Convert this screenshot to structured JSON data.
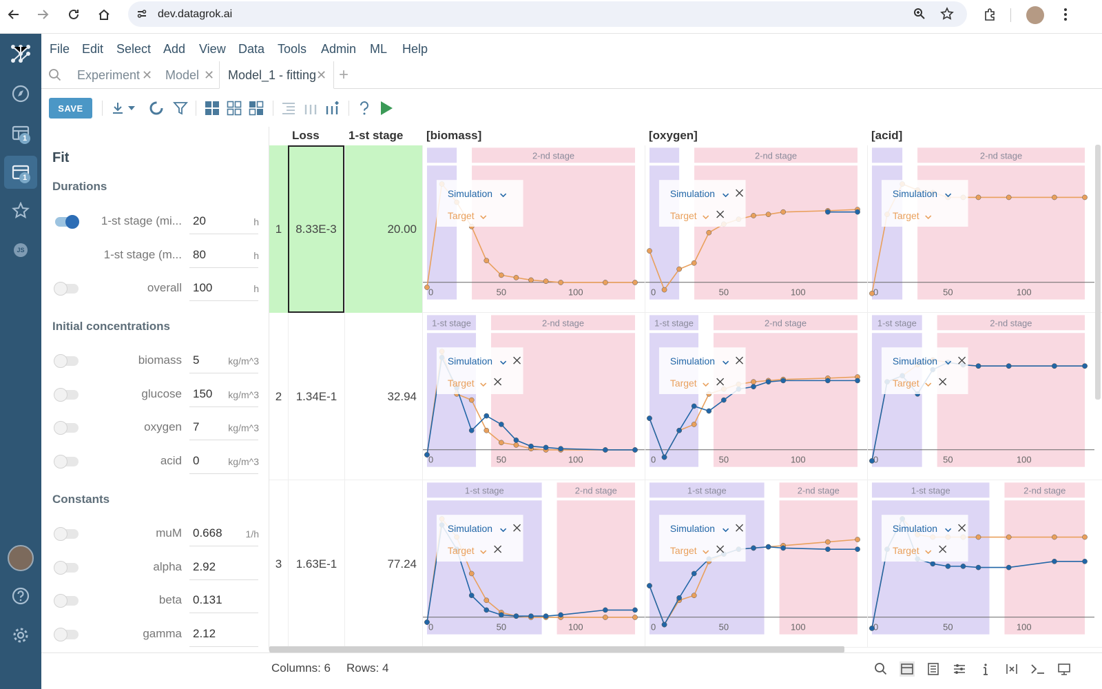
{
  "browser": {
    "url": "dev.datagrok.ai"
  },
  "menu": [
    "File",
    "Edit",
    "Select",
    "Add",
    "View",
    "Data",
    "Tools",
    "Admin",
    "ML",
    "Help"
  ],
  "tabs": [
    {
      "label": "Experiment",
      "active": false
    },
    {
      "label": "Model",
      "active": false
    },
    {
      "label": "Model_1 - fitting",
      "active": true
    }
  ],
  "sidebar": {
    "badge_tables": "1",
    "badge_projects": "1",
    "js_label": "JS"
  },
  "toolbar": {
    "save_label": "SAVE"
  },
  "fit": {
    "title": "Fit",
    "durations_title": "Durations",
    "durations": [
      {
        "label": "1-st stage (mi...",
        "value": "20",
        "unit": "h",
        "toggle": true,
        "show_toggle": true
      },
      {
        "label": "1-st stage (m...",
        "value": "80",
        "unit": "h",
        "toggle": false,
        "show_toggle": false
      },
      {
        "label": "overall",
        "value": "100",
        "unit": "h",
        "toggle": false,
        "show_toggle": true
      }
    ],
    "initial_title": "Initial concentrations",
    "initial": [
      {
        "label": "biomass",
        "value": "5",
        "unit": "kg/m^3"
      },
      {
        "label": "glucose",
        "value": "150",
        "unit": "kg/m^3"
      },
      {
        "label": "oxygen",
        "value": "7",
        "unit": "kg/m^3"
      },
      {
        "label": "acid",
        "value": "0",
        "unit": "kg/m^3"
      }
    ],
    "constants_title": "Constants",
    "constants": [
      {
        "label": "muM",
        "value": "0.668",
        "unit": "1/h"
      },
      {
        "label": "alpha",
        "value": "2.92",
        "unit": ""
      },
      {
        "label": "beta",
        "value": "0.131",
        "unit": ""
      },
      {
        "label": "gamma",
        "value": "2.12",
        "unit": ""
      }
    ]
  },
  "grid": {
    "headers": {
      "loss": "Loss",
      "stage": "1-st stage",
      "biomass": "[biomass]",
      "oxygen": "[oxygen]",
      "acid": "[acid]"
    },
    "rows": [
      {
        "num": "1",
        "loss": "8.33E-3",
        "stage": "20.00"
      },
      {
        "num": "2",
        "loss": "1.34E-1",
        "stage": "32.94"
      },
      {
        "num": "3",
        "loss": "1.63E-1",
        "stage": "77.24"
      }
    ],
    "stage1_label": "1-st stage",
    "stage2_label": "2-nd stage",
    "sim_label": "Simulation",
    "target_label": "Target",
    "axis_ticks": [
      "0",
      "50",
      "100"
    ]
  },
  "chart_data": {
    "type": "line",
    "xlim": [
      0,
      140
    ],
    "stage_ends": [
      20,
      32.94,
      77.24
    ],
    "rows": [
      {
        "biomass": {
          "target": [
            [
              0,
              0.1
            ],
            [
              10,
              0.95
            ],
            [
              20,
              0.8
            ],
            [
              30,
              0.6
            ],
            [
              40,
              0.32
            ],
            [
              50,
              0.2
            ],
            [
              60,
              0.18
            ],
            [
              70,
              0.16
            ],
            [
              80,
              0.15
            ],
            [
              90,
              0.14
            ],
            [
              120,
              0.14
            ],
            [
              140,
              0.14
            ]
          ],
          "simulation": []
        },
        "oxygen": {
          "target": [
            [
              0,
              0.4
            ],
            [
              10,
              0.08
            ],
            [
              20,
              0.25
            ],
            [
              30,
              0.3
            ],
            [
              40,
              0.55
            ],
            [
              50,
              0.62
            ],
            [
              60,
              0.66
            ],
            [
              70,
              0.69
            ],
            [
              80,
              0.7
            ],
            [
              90,
              0.72
            ],
            [
              120,
              0.73
            ],
            [
              140,
              0.74
            ]
          ],
          "simulation": [
            [
              120,
              0.72
            ],
            [
              140,
              0.72
            ]
          ]
        },
        "acid": {
          "target": [
            [
              0,
              0.05
            ],
            [
              10,
              0.7
            ],
            [
              20,
              0.95
            ],
            [
              30,
              0.9
            ],
            [
              40,
              0.88
            ],
            [
              50,
              0.84
            ],
            [
              60,
              0.84
            ],
            [
              70,
              0.84
            ],
            [
              90,
              0.84
            ],
            [
              120,
              0.84
            ],
            [
              140,
              0.84
            ]
          ],
          "simulation": []
        }
      },
      {
        "biomass": {
          "target": [
            [
              0,
              0.1
            ],
            [
              10,
              0.95
            ],
            [
              20,
              0.6
            ],
            [
              30,
              0.55
            ],
            [
              40,
              0.3
            ],
            [
              50,
              0.2
            ],
            [
              60,
              0.18
            ],
            [
              70,
              0.15
            ],
            [
              80,
              0.14
            ],
            [
              90,
              0.14
            ],
            [
              120,
              0.14
            ],
            [
              140,
              0.14
            ]
          ],
          "simulation": [
            [
              0,
              0.1
            ],
            [
              10,
              0.9
            ],
            [
              20,
              0.65
            ],
            [
              30,
              0.3
            ],
            [
              40,
              0.42
            ],
            [
              50,
              0.35
            ],
            [
              60,
              0.22
            ],
            [
              70,
              0.17
            ],
            [
              80,
              0.16
            ],
            [
              90,
              0.15
            ],
            [
              120,
              0.14
            ],
            [
              140,
              0.14
            ]
          ]
        },
        "oxygen": {
          "target": [
            [
              0,
              0.4
            ],
            [
              10,
              0.08
            ],
            [
              20,
              0.3
            ],
            [
              30,
              0.35
            ],
            [
              40,
              0.6
            ],
            [
              50,
              0.64
            ],
            [
              60,
              0.68
            ],
            [
              70,
              0.7
            ],
            [
              80,
              0.71
            ],
            [
              90,
              0.72
            ],
            [
              120,
              0.73
            ],
            [
              140,
              0.74
            ]
          ],
          "simulation": [
            [
              0,
              0.4
            ],
            [
              10,
              0.08
            ],
            [
              20,
              0.3
            ],
            [
              30,
              0.5
            ],
            [
              40,
              0.46
            ],
            [
              50,
              0.55
            ],
            [
              60,
              0.64
            ],
            [
              70,
              0.66
            ],
            [
              80,
              0.7
            ],
            [
              90,
              0.71
            ],
            [
              120,
              0.71
            ],
            [
              140,
              0.71
            ]
          ]
        },
        "acid": {
          "target": [
            [
              0,
              0.05
            ],
            [
              10,
              0.7
            ],
            [
              20,
              0.75
            ],
            [
              30,
              0.84
            ],
            [
              40,
              0.88
            ],
            [
              50,
              0.86
            ],
            [
              60,
              0.84
            ],
            [
              70,
              0.83
            ],
            [
              90,
              0.83
            ],
            [
              120,
              0.83
            ],
            [
              140,
              0.83
            ]
          ],
          "simulation": [
            [
              0,
              0.05
            ],
            [
              10,
              0.7
            ],
            [
              20,
              0.75
            ],
            [
              30,
              0.6
            ],
            [
              40,
              0.8
            ],
            [
              50,
              0.86
            ],
            [
              60,
              0.84
            ],
            [
              70,
              0.83
            ],
            [
              90,
              0.83
            ],
            [
              120,
              0.83
            ],
            [
              140,
              0.83
            ]
          ]
        }
      },
      {
        "biomass": {
          "target": [
            [
              0,
              0.1
            ],
            [
              10,
              0.95
            ],
            [
              20,
              0.8
            ],
            [
              30,
              0.5
            ],
            [
              40,
              0.28
            ],
            [
              50,
              0.18
            ],
            [
              60,
              0.15
            ],
            [
              70,
              0.14
            ],
            [
              80,
              0.14
            ],
            [
              90,
              0.14
            ],
            [
              120,
              0.14
            ],
            [
              140,
              0.14
            ]
          ],
          "simulation": [
            [
              0,
              0.1
            ],
            [
              10,
              0.9
            ],
            [
              20,
              0.7
            ],
            [
              30,
              0.32
            ],
            [
              40,
              0.2
            ],
            [
              50,
              0.16
            ],
            [
              60,
              0.15
            ],
            [
              70,
              0.15
            ],
            [
              80,
              0.15
            ],
            [
              90,
              0.16
            ],
            [
              120,
              0.2
            ],
            [
              140,
              0.2
            ]
          ]
        },
        "oxygen": {
          "target": [
            [
              0,
              0.4
            ],
            [
              10,
              0.08
            ],
            [
              20,
              0.28
            ],
            [
              30,
              0.32
            ],
            [
              40,
              0.6
            ],
            [
              50,
              0.66
            ],
            [
              60,
              0.7
            ],
            [
              70,
              0.71
            ],
            [
              80,
              0.72
            ],
            [
              90,
              0.73
            ],
            [
              120,
              0.76
            ],
            [
              140,
              0.78
            ]
          ],
          "simulation": [
            [
              0,
              0.4
            ],
            [
              10,
              0.08
            ],
            [
              20,
              0.3
            ],
            [
              30,
              0.5
            ],
            [
              40,
              0.62
            ],
            [
              50,
              0.66
            ],
            [
              60,
              0.7
            ],
            [
              70,
              0.71
            ],
            [
              80,
              0.72
            ],
            [
              90,
              0.71
            ],
            [
              120,
              0.7
            ],
            [
              140,
              0.7
            ]
          ]
        },
        "acid": {
          "target": [
            [
              0,
              0.05
            ],
            [
              10,
              0.7
            ],
            [
              20,
              0.95
            ],
            [
              30,
              0.82
            ],
            [
              40,
              0.8
            ],
            [
              50,
              0.8
            ],
            [
              60,
              0.8
            ],
            [
              70,
              0.8
            ],
            [
              90,
              0.8
            ],
            [
              120,
              0.8
            ],
            [
              140,
              0.8
            ]
          ],
          "simulation": [
            [
              0,
              0.05
            ],
            [
              10,
              0.7
            ],
            [
              20,
              0.95
            ],
            [
              30,
              0.62
            ],
            [
              40,
              0.58
            ],
            [
              50,
              0.56
            ],
            [
              60,
              0.56
            ],
            [
              70,
              0.55
            ],
            [
              90,
              0.55
            ],
            [
              120,
              0.6
            ],
            [
              140,
              0.6
            ]
          ]
        }
      }
    ]
  },
  "status": {
    "columns": "Columns: 6",
    "rows": "Rows: 4"
  }
}
